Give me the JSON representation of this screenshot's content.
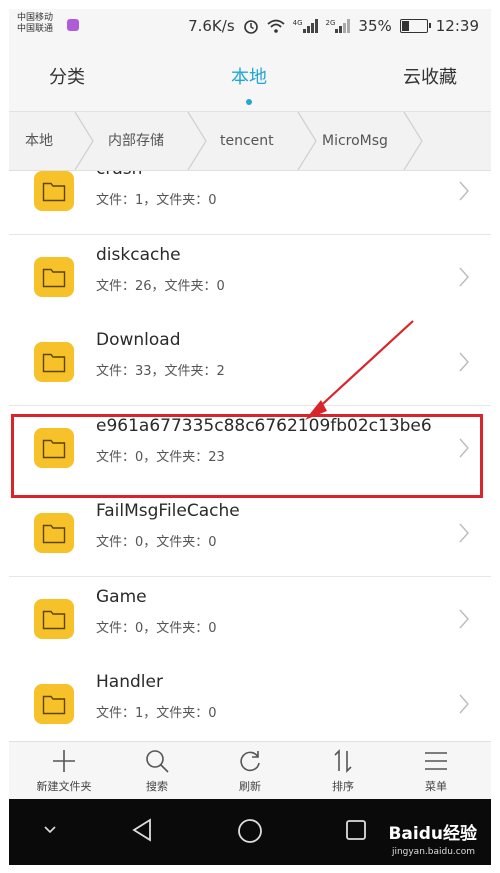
{
  "status_bar": {
    "carrier1": "中国移动",
    "carrier2": "中国联通",
    "speed": "7.6K/s",
    "net1": "4G",
    "net2": "2G",
    "battery": "35%",
    "battery_level": 0.35,
    "time": "12:39"
  },
  "tabs": [
    {
      "label": "分类"
    },
    {
      "label": "本地"
    },
    {
      "label": "云收藏"
    }
  ],
  "active_tab": "本地",
  "breadcrumb": [
    "本地",
    "内部存储",
    "tencent",
    "MicroMsg"
  ],
  "folders": [
    {
      "name": "crash",
      "meta": "文件：1，文件夹：0"
    },
    {
      "name": "diskcache",
      "meta": "文件：26，文件夹：0"
    },
    {
      "name": "Download",
      "meta": "文件：33，文件夹：2"
    },
    {
      "name": "e961a677335c88c6762109fb02c13be6",
      "meta": "文件：0，文件夹：23"
    },
    {
      "name": "FailMsgFileCache",
      "meta": "文件：0，文件夹：0"
    },
    {
      "name": "Game",
      "meta": "文件：0，文件夹：0"
    },
    {
      "name": "Handler",
      "meta": "文件：1，文件夹：0"
    }
  ],
  "highlighted_folder": "e961a677335c88c6762109fb02c13be6",
  "toolbar": [
    {
      "label": "新建文件夹",
      "icon": "plus-icon"
    },
    {
      "label": "搜索",
      "icon": "search-icon"
    },
    {
      "label": "刷新",
      "icon": "refresh-icon"
    },
    {
      "label": "排序",
      "icon": "sort-icon"
    },
    {
      "label": "菜单",
      "icon": "menu-icon"
    }
  ],
  "watermark": {
    "brand": "Baidu经验",
    "url": "jingyan.baidu.com"
  },
  "colors": {
    "accent": "#22a6d3",
    "folder": "#f7c12a",
    "highlight": "#d9252a"
  }
}
